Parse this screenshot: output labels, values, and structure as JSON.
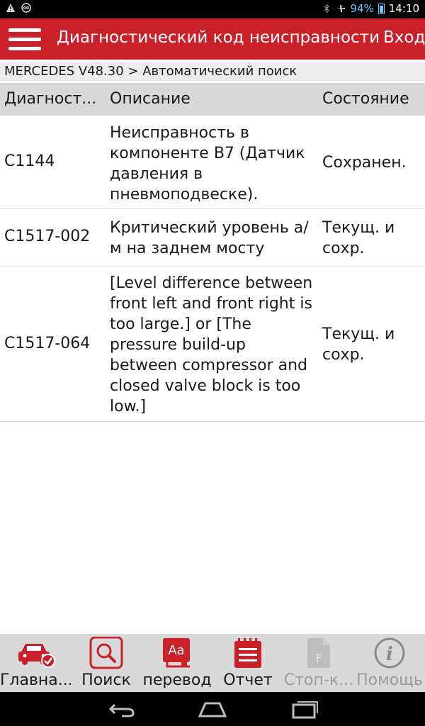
{
  "status_bar": {
    "battery": "94%",
    "time": "14:10",
    "left_icons": [
      "warning-icon",
      "voicemail-icon"
    ],
    "right_icons": [
      "bluetooth-icon",
      "airplane-icon",
      "battery-icon"
    ]
  },
  "app_bar": {
    "title": "Диагностический код неисправности",
    "right_action": "Вход"
  },
  "breadcrumb": "MERCEDES V48.30 > Автоматический поиск",
  "table": {
    "headers": [
      "Диагност...",
      "Описание",
      "Состояние"
    ],
    "rows": [
      {
        "code": "C1144",
        "description": "Неисправность в компоненте B7 (Датчик давления в пневмоподвеске).",
        "state": "Сохранен."
      },
      {
        "code": "C1517-002",
        "description": "Критический уровень а/м на заднем мосту",
        "state": "Текущ. и сохр."
      },
      {
        "code": "C1517-064",
        "description": "[Level difference between front left and front right is too large.] or [The pressure build-up between compressor and closed valve block is too low.]",
        "state": "Текущ. и сохр."
      }
    ]
  },
  "toolbar": {
    "items": [
      {
        "label": "Главна...",
        "icon": "car-check-icon",
        "enabled": true
      },
      {
        "label": "Поиск",
        "icon": "search-icon",
        "enabled": true
      },
      {
        "label": "перевод",
        "icon": "dictionary-icon",
        "enabled": true
      },
      {
        "label": "Отчет",
        "icon": "report-icon",
        "enabled": true
      },
      {
        "label": "Стоп-к...",
        "icon": "document-icon",
        "enabled": false
      },
      {
        "label": "Помощь",
        "icon": "info-icon",
        "enabled": false
      }
    ]
  },
  "nav_bar": {
    "buttons": [
      "back-icon",
      "home-icon",
      "recent-apps-icon"
    ]
  },
  "colors": {
    "accent": "#c9202a",
    "header_bg": "#d8d8d8",
    "toolbar_bg": "#d9d9d9"
  }
}
